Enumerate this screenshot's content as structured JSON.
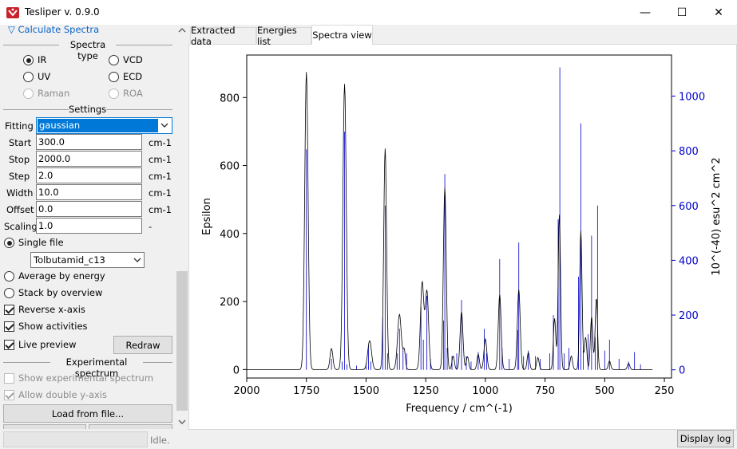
{
  "window": {
    "title": "Tesliper v. 0.9.0",
    "controls": {
      "minimize": "—",
      "maximize": "☐",
      "close": "✕"
    }
  },
  "left_panel": {
    "collapse_link": "▽ Calculate Spectra",
    "spectra_type": {
      "title": "Spectra type",
      "options": [
        {
          "label": "IR",
          "checked": true,
          "disabled": false
        },
        {
          "label": "VCD",
          "checked": false,
          "disabled": false
        },
        {
          "label": "UV",
          "checked": false,
          "disabled": false
        },
        {
          "label": "ECD",
          "checked": false,
          "disabled": false
        },
        {
          "label": "Raman",
          "checked": false,
          "disabled": true
        },
        {
          "label": "ROA",
          "checked": false,
          "disabled": true
        }
      ]
    },
    "settings": {
      "title": "Settings",
      "fitting_label": "Fitting",
      "fitting_value": "gaussian",
      "fields": [
        {
          "label": "Start",
          "value": "300.0",
          "unit": "cm-1"
        },
        {
          "label": "Stop",
          "value": "2000.0",
          "unit": "cm-1"
        },
        {
          "label": "Step",
          "value": "2.0",
          "unit": "cm-1"
        },
        {
          "label": "Width",
          "value": "10.0",
          "unit": "cm-1"
        },
        {
          "label": "Offset",
          "value": "0.0",
          "unit": "cm-1"
        },
        {
          "label": "Scaling",
          "value": "1.0",
          "unit": "-"
        }
      ]
    },
    "mode": {
      "single_file": "Single file",
      "single_file_combo": "Tolbutamid_c13",
      "average": "Average by energy",
      "stack": "Stack by overview"
    },
    "checks": {
      "reverse": "Reverse x-axis",
      "activities": "Show activities",
      "live_preview": "Live preview",
      "redraw": "Redraw"
    },
    "experimental": {
      "title": "Experimental spectrum",
      "show": "Show experimental spectrum",
      "double": "Allow double y-axis",
      "load": "Load from file..."
    }
  },
  "tabs": [
    "Extracted data",
    "Energies list",
    "Spectra view"
  ],
  "status": {
    "text": "Idle.",
    "display_log": "Display log"
  },
  "colors": {
    "spectrum": "#000000",
    "activities": "#0000cc",
    "link": "#0a64c8"
  },
  "chart_data": {
    "type": "line",
    "xlabel": "Frequency / cm^(-1)",
    "ylabel": "Epsilon",
    "ylabel_right": "10^(-40) esu^2 cm^2",
    "xlim": [
      2000,
      220
    ],
    "x_reversed": true,
    "ylim": [
      -25,
      925
    ],
    "ylim_right": [
      -30,
      1150
    ],
    "x_ticks": [
      2000,
      1750,
      1500,
      1250,
      1000,
      750,
      500,
      250
    ],
    "y_ticks": [
      0,
      200,
      400,
      600,
      800
    ],
    "y_ticks_right": [
      0,
      200,
      400,
      600,
      800,
      1000
    ],
    "grid": false,
    "series": [
      {
        "values_note": "spectrum",
        "peaks": [
          {
            "x": 1750,
            "y": 875,
            "w": 7
          },
          {
            "x": 1645,
            "y": 62,
            "w": 6
          },
          {
            "x": 1590,
            "y": 840,
            "w": 7
          },
          {
            "x": 1485,
            "y": 85,
            "w": 8
          },
          {
            "x": 1420,
            "y": 650,
            "w": 6
          },
          {
            "x": 1360,
            "y": 162,
            "w": 8
          },
          {
            "x": 1340,
            "y": 55,
            "w": 5
          },
          {
            "x": 1265,
            "y": 255,
            "w": 7
          },
          {
            "x": 1245,
            "y": 230,
            "w": 7
          },
          {
            "x": 1170,
            "y": 535,
            "w": 6
          },
          {
            "x": 1135,
            "y": 40,
            "w": 5
          },
          {
            "x": 1100,
            "y": 170,
            "w": 6
          },
          {
            "x": 1075,
            "y": 38,
            "w": 5
          },
          {
            "x": 1030,
            "y": 45,
            "w": 5
          },
          {
            "x": 1000,
            "y": 90,
            "w": 6
          },
          {
            "x": 940,
            "y": 220,
            "w": 6
          },
          {
            "x": 860,
            "y": 235,
            "w": 6
          },
          {
            "x": 820,
            "y": 50,
            "w": 5
          },
          {
            "x": 780,
            "y": 35,
            "w": 5
          },
          {
            "x": 710,
            "y": 150,
            "w": 5
          },
          {
            "x": 690,
            "y": 455,
            "w": 5
          },
          {
            "x": 640,
            "y": 40,
            "w": 5
          },
          {
            "x": 600,
            "y": 408,
            "w": 5
          },
          {
            "x": 580,
            "y": 95,
            "w": 5
          },
          {
            "x": 555,
            "y": 155,
            "w": 5
          },
          {
            "x": 535,
            "y": 210,
            "w": 5
          },
          {
            "x": 480,
            "y": 25,
            "w": 5
          },
          {
            "x": 400,
            "y": 18,
            "w": 5
          }
        ]
      },
      {
        "values_note": "activities",
        "sticks": [
          {
            "x": 1750,
            "y": 805
          },
          {
            "x": 1645,
            "y": 40
          },
          {
            "x": 1600,
            "y": 30
          },
          {
            "x": 1590,
            "y": 870
          },
          {
            "x": 1580,
            "y": 20
          },
          {
            "x": 1540,
            "y": 15
          },
          {
            "x": 1500,
            "y": 25
          },
          {
            "x": 1490,
            "y": 90
          },
          {
            "x": 1480,
            "y": 30
          },
          {
            "x": 1430,
            "y": 190
          },
          {
            "x": 1420,
            "y": 600
          },
          {
            "x": 1410,
            "y": 60
          },
          {
            "x": 1370,
            "y": 60
          },
          {
            "x": 1360,
            "y": 150
          },
          {
            "x": 1345,
            "y": 80
          },
          {
            "x": 1330,
            "y": 60
          },
          {
            "x": 1270,
            "y": 230
          },
          {
            "x": 1260,
            "y": 110
          },
          {
            "x": 1245,
            "y": 270
          },
          {
            "x": 1230,
            "y": 40
          },
          {
            "x": 1175,
            "y": 180
          },
          {
            "x": 1170,
            "y": 715
          },
          {
            "x": 1160,
            "y": 80
          },
          {
            "x": 1140,
            "y": 50
          },
          {
            "x": 1120,
            "y": 60
          },
          {
            "x": 1100,
            "y": 255
          },
          {
            "x": 1080,
            "y": 50
          },
          {
            "x": 1060,
            "y": 30
          },
          {
            "x": 1030,
            "y": 65
          },
          {
            "x": 1005,
            "y": 150
          },
          {
            "x": 995,
            "y": 60
          },
          {
            "x": 940,
            "y": 405
          },
          {
            "x": 930,
            "y": 80
          },
          {
            "x": 900,
            "y": 40
          },
          {
            "x": 865,
            "y": 145
          },
          {
            "x": 860,
            "y": 465
          },
          {
            "x": 840,
            "y": 50
          },
          {
            "x": 820,
            "y": 70
          },
          {
            "x": 790,
            "y": 50
          },
          {
            "x": 770,
            "y": 40
          },
          {
            "x": 730,
            "y": 60
          },
          {
            "x": 715,
            "y": 200
          },
          {
            "x": 695,
            "y": 550
          },
          {
            "x": 688,
            "y": 1105
          },
          {
            "x": 670,
            "y": 60
          },
          {
            "x": 650,
            "y": 80
          },
          {
            "x": 610,
            "y": 340
          },
          {
            "x": 600,
            "y": 900
          },
          {
            "x": 590,
            "y": 70
          },
          {
            "x": 570,
            "y": 130
          },
          {
            "x": 555,
            "y": 490
          },
          {
            "x": 540,
            "y": 120
          },
          {
            "x": 530,
            "y": 600
          },
          {
            "x": 500,
            "y": 70
          },
          {
            "x": 480,
            "y": 110
          },
          {
            "x": 440,
            "y": 40
          },
          {
            "x": 400,
            "y": 30
          },
          {
            "x": 375,
            "y": 65
          },
          {
            "x": 350,
            "y": 20
          }
        ]
      }
    ]
  }
}
